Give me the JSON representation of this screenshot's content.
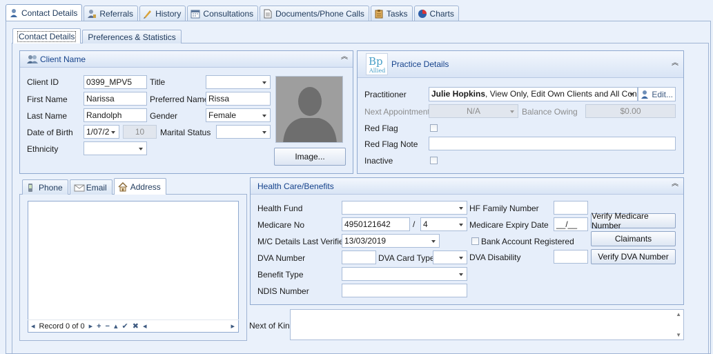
{
  "top_tabs": [
    {
      "label": "Contact Details",
      "icon": "contact-icon",
      "active": true
    },
    {
      "label": "Referrals",
      "icon": "referrals-icon"
    },
    {
      "label": "History",
      "icon": "history-icon"
    },
    {
      "label": "Consultations",
      "icon": "calendar-icon"
    },
    {
      "label": "Documents/Phone Calls",
      "icon": "document-icon"
    },
    {
      "label": "Tasks",
      "icon": "tasks-icon"
    },
    {
      "label": "Charts",
      "icon": "charts-icon"
    }
  ],
  "sub_tabs": [
    "Contact Details",
    "Preferences & Statistics"
  ],
  "client": {
    "title": "Client Name",
    "client_id_label": "Client ID",
    "client_id": "0399_MPV5",
    "title_label": "Title",
    "title_value": "",
    "first_name_label": "First Name",
    "first_name": "Narissa",
    "preferred_name_label": "Preferred Name",
    "preferred_name": "Rissa",
    "last_name_label": "Last Name",
    "last_name": "Randolph",
    "gender_label": "Gender",
    "gender": "Female",
    "dob_label": "Date of Birth",
    "dob": "1/07/2",
    "age": "10",
    "marital_label": "Marital Status",
    "marital": "",
    "ethnicity_label": "Ethnicity",
    "ethnicity": "",
    "image_button": "Image..."
  },
  "practice": {
    "title": "Practice Details",
    "logo_text": "Bp",
    "logo_sub": "Allied",
    "practitioner_label": "Practitioner",
    "practitioner_name": "Julie Hopkins",
    "practitioner_rest": ", View Only, Edit Own Clients and All Con...",
    "edit_label": "Edit...",
    "next_appt_label": "Next Appointment",
    "next_appt": "N/A",
    "balance_label": "Balance Owing",
    "balance": "$0.00",
    "red_flag_label": "Red Flag",
    "red_flag_note_label": "Red Flag Note",
    "red_flag_note": "",
    "inactive_label": "Inactive"
  },
  "contact_tabs": [
    {
      "label": "Phone",
      "icon": "phone-icon"
    },
    {
      "label": "Email",
      "icon": "email-icon"
    },
    {
      "label": "Address",
      "icon": "home-icon",
      "active": true
    }
  ],
  "navigator": {
    "record_text": "Record 0 of 0"
  },
  "health": {
    "title": "Health Care/Benefits",
    "health_fund_label": "Health Fund",
    "health_fund": "",
    "hf_family_label": "HF Family Number",
    "hf_family": "",
    "medicare_label": "Medicare No",
    "medicare_no": "4950121642",
    "slash": "/",
    "medicare_irn": "4",
    "medicare_expiry_label": "Medicare Expiry Date",
    "medicare_expiry": "__/__",
    "verify_medicare": "Verify Medicare Number",
    "mc_verified_label": "M/C Details Last Verified",
    "mc_verified": "13/03/2019",
    "bank_label": "Bank Account Registered",
    "claimants": "Claimants",
    "dva_label": "DVA Number",
    "dva": "",
    "dva_card_label": "DVA Card Type",
    "dva_card": "",
    "dva_disability_label": "DVA Disability",
    "dva_disability": "",
    "verify_dva": "Verify DVA Number",
    "benefit_label": "Benefit Type",
    "benefit": "",
    "ndis_label": "NDIS Number",
    "ndis": ""
  },
  "next_of_kin_label": "Next of Kin",
  "colors": {
    "accent": "#15428b",
    "panel_border": "#8fa9cf",
    "background": "#eaf1fb"
  }
}
